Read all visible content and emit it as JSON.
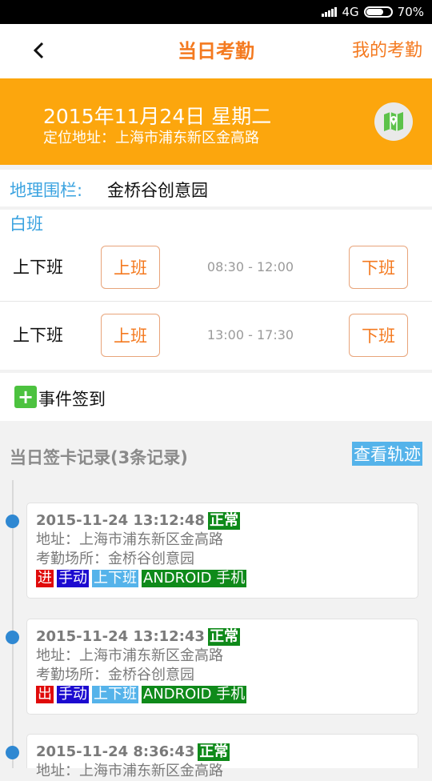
{
  "status": {
    "network": "4G",
    "battery": "70%",
    "battery_level": 0.7
  },
  "header": {
    "title": "当日考勤",
    "right_link": "我的考勤"
  },
  "banner": {
    "date": "2015年11月24日 星期二",
    "location": "定位地址：上海市浦东新区金高路"
  },
  "fence": {
    "label": "地理围栏:",
    "value": "金桥谷创意园"
  },
  "shift": {
    "name": "白班",
    "rows": [
      {
        "label": "上下班",
        "on": "上班",
        "time": "08:30 - 12:00",
        "off": "下班"
      },
      {
        "label": "上下班",
        "on": "上班",
        "time": "13:00 - 17:30",
        "off": "下班"
      }
    ]
  },
  "event": {
    "label": "事件签到"
  },
  "records": {
    "title": "当日签卡记录(3条记录)",
    "track_button": "查看轨迹",
    "items": [
      {
        "time": "2015-11-24 13:12:48",
        "status": "正常",
        "address": "地址：上海市浦东新区金高路",
        "place": "考勤场所：金桥谷创意园",
        "dir": "进",
        "mode": "手动",
        "type": "上下班",
        "device": "ANDROID 手机"
      },
      {
        "time": "2015-11-24 13:12:43",
        "status": "正常",
        "address": "地址：上海市浦东新区金高路",
        "place": "考勤场所：金桥谷创意园",
        "dir": "出",
        "mode": "手动",
        "type": "上下班",
        "device": "ANDROID 手机"
      },
      {
        "time": "2015-11-24 8:36:43",
        "status": "正常",
        "address": "地址：上海市浦东新区金高路",
        "place": "",
        "dir": "",
        "mode": "",
        "type": "",
        "device": ""
      }
    ]
  },
  "colors": {
    "accent": "#f47a20",
    "banner": "#fca60d",
    "link_blue": "#3ba3e0",
    "ok_green": "#0f8a1a"
  }
}
